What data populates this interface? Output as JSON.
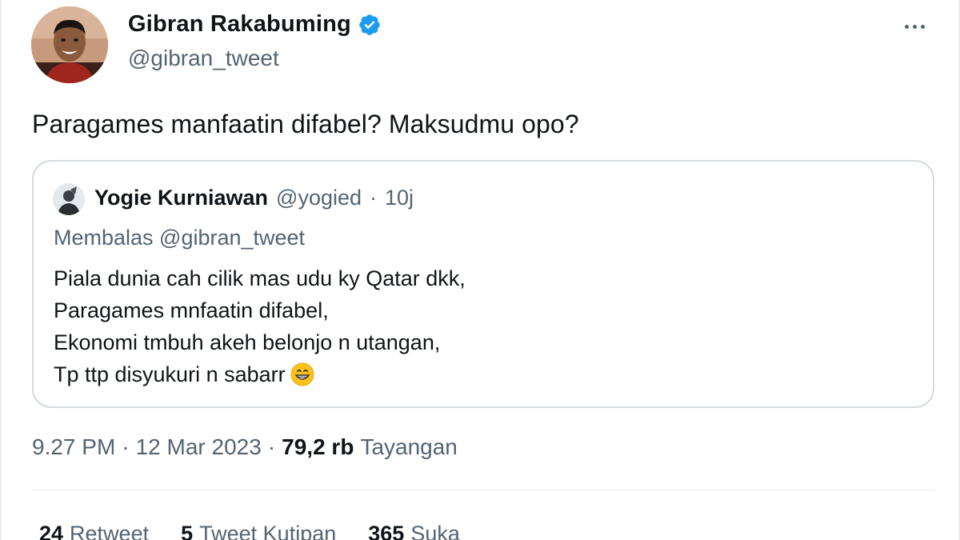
{
  "author": {
    "display_name": "Gibran Rakabuming",
    "handle": "@gibran_tweet",
    "avatar_icon": "profile-photo",
    "verified_icon": "verified-badge-icon",
    "verified_color": "#1d9bf0"
  },
  "more_icon": "more-horizontal-icon",
  "tweet": {
    "text": "Paragames manfaatin difabel? Maksudmu opo?"
  },
  "quoted": {
    "display_name": "Yogie Kurniawan",
    "handle": "@yogied",
    "separator": "·",
    "time": "10j",
    "reply_to": "Membalas @gibran_tweet",
    "lines": [
      "Piala dunia cah cilik mas udu ky Qatar dkk,",
      "Paragames mnfaatin difabel,",
      "Ekonomi tmbuh akeh belonjo n utangan,",
      "Tp ttp disyukuri n sabarr"
    ],
    "emoji_icon": "grinning-face-emoji"
  },
  "meta": {
    "time": "9.27 PM",
    "sep1": "·",
    "date": "12 Mar 2023",
    "sep2": "·",
    "views_count": "79,2 rb",
    "views_label": "Tayangan"
  },
  "stats": {
    "retweets_count": "24",
    "retweets_label": "Retweet",
    "quotes_count": "5",
    "quotes_label": "Tweet Kutipan",
    "likes_count": "365",
    "likes_label": "Suka"
  }
}
